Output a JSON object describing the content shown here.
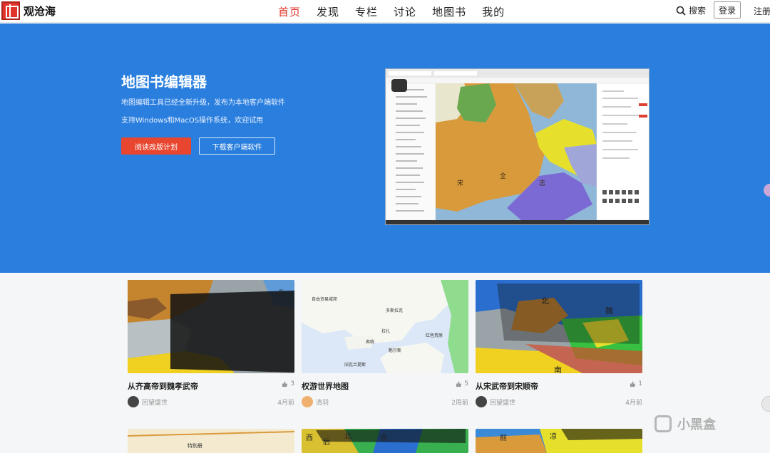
{
  "header": {
    "logo_text": "观沧海",
    "nav": [
      "首页",
      "发现",
      "专栏",
      "讨论",
      "地图书",
      "我的"
    ],
    "active_nav": "首页",
    "search_label": "搜索",
    "login_label": "登录",
    "register_label": "注册"
  },
  "hero": {
    "title": "地图书编辑器",
    "line1": "地图编辑工具已经全新升级，发布为本地客户端软件",
    "line2": "支持Windows和MacOS操作系统，欢迎试用",
    "primary_button": "阅读改版计划",
    "secondary_button": "下载客户端软件",
    "bg_color": "#2a7fde",
    "screenshot_labels": [
      "宋",
      "全",
      "志"
    ]
  },
  "cards": [
    {
      "title": "从齐高帝到魏孝武帝",
      "likes": "3",
      "author": "回望盛世",
      "time": "4月前",
      "map_labels": [
        "北"
      ]
    },
    {
      "title": "权游世界地图",
      "likes": "5",
      "author": "清羽",
      "time": "2周前",
      "map_labels": [
        "自由贸易城邦",
        "多斯拉克",
        "拉扎",
        "红色荒原",
        "君临",
        "魁尔斯",
        "旧瓦兰提斯"
      ]
    },
    {
      "title": "从宋武帝到宋顺帝",
      "likes": "1",
      "author": "回望盛世",
      "time": "4月前",
      "map_labels": [
        "北",
        "魏",
        "南"
      ]
    }
  ],
  "bottom_cards_labels": [
    "特别册",
    "西",
    "后",
    "北",
    "凉",
    "前",
    "凉"
  ],
  "watermark": "小黑盒"
}
